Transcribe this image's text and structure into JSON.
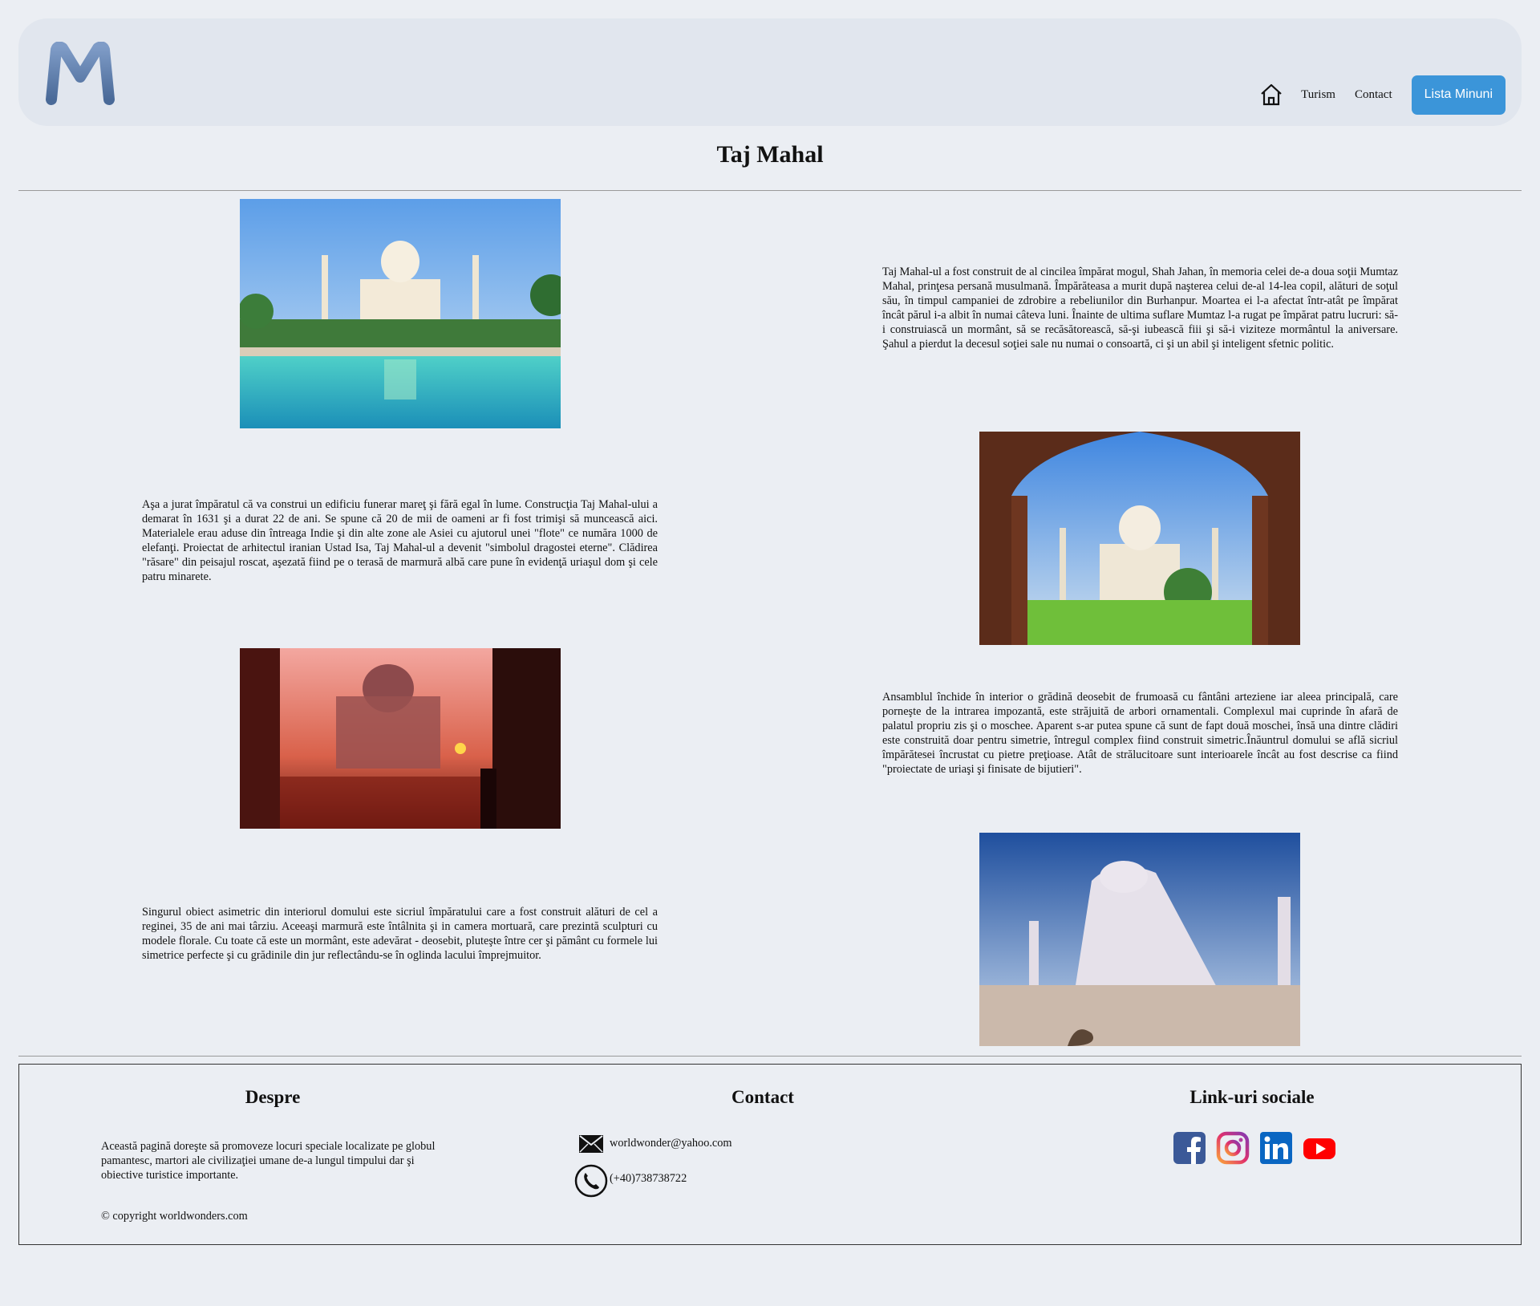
{
  "header": {
    "logo_letter": "M",
    "nav": {
      "home_icon": "home-icon",
      "turism": "Turism",
      "contact": "Contact",
      "cta": "Lista Minuni"
    },
    "colors": {
      "cta": "#3b95d9",
      "header_bg": "#e1e6ee",
      "page_bg": "#ebeef3"
    }
  },
  "main": {
    "title": "Taj Mahal",
    "paragraphs": [
      "Taj Mahal-ul a fost construit de al cincilea împărat mogul, Shah Jahan, în memoria celei de-a doua soţii Mumtaz Mahal, prinţesa persană musulmană. Împărăteasa a murit după naşterea celui de-al 14-lea copil, alături de soţul său, în timpul campaniei de zdrobire a rebeliunilor din Burhanpur. Moartea ei l-a afectat într-atât pe împărat încât părul i-a albit în numai câteva luni. Înainte de ultima suflare Mumtaz l-a rugat pe împărat patru lucruri: să-i construiască un mormânt, să se recăsătorească, să-şi iubească fiii şi să-i viziteze mormântul la aniversare. Şahul a pierdut la decesul soţiei sale nu numai o consoartă, ci şi un abil şi inteligent sfetnic politic.",
      "Aşa a jurat împăratul că va construi un edificiu funerar mareţ şi fără egal în lume. Construcţia Taj Mahal-ului a demarat în 1631 şi a durat 22 de ani. Se spune că 20 de mii de oameni ar fi fost trimişi să muncească aici. Materialele erau aduse din întreaga Indie şi din alte zone ale Asiei cu ajutorul unei \"flote\" ce număra 1000 de elefanţi. Proiectat de arhitectul iranian Ustad Isa, Taj Mahal-ul a devenit \"simbolul dragostei eterne\". Clădirea \"răsare\" din peisajul roscat, aşezată fiind pe o terasă de marmură albă care pune în evidenţă uriaşul dom şi cele patru minarete.",
      "Ansamblul închide în interior o grădină deosebit de frumoasă cu fântâni arteziene iar aleea principală, care porneşte de la intrarea impozantă, este străjuită de arbori ornamentali. Complexul mai cuprinde în afară de palatul propriu zis şi o moschee. Aparent s-ar putea spune că sunt de fapt două moschei, însă una dintre clădiri este construită doar pentru simetrie, întregul complex fiind construit simetric.Înăuntrul domului se află sicriul împărătesei încrustat cu pietre preţioase. Atât de strălucitoare sunt interioarele încât au fost descrise ca fiind \"proiectate de uriaşi şi finisate de bijutieri\".",
      "Singurul obiect asimetric din interiorul domului este sicriul împăratului care a fost construit alături de cel a reginei, 35 de ani mai târziu. Aceeaşi marmură este întâlnita şi in camera mortuară, care prezintă sculpturi cu modele florale. Cu toate că este un mormânt, este adevărat - deosebit, pluteşte între cer şi pământ cu formele lui simetrice perfecte şi cu grădinile din jur reflectându-se în oglinda lacului împrejmuitor."
    ]
  },
  "footer": {
    "about": {
      "title": "Despre",
      "text": "Această pagină doreşte să promoveze locuri speciale localizate pe globul pamantesc, martori ale civilizaţiei umane de-a lungul timpului dar şi obiective turistice importante.",
      "copyright": "© copyright worldwonders.com"
    },
    "contact": {
      "title": "Contact",
      "email": "worldwonder@yahoo.com",
      "phone": "(+40)738738722",
      "email_icon": "envelope-icon",
      "phone_icon": "phone-icon"
    },
    "social": {
      "title": "Link-uri sociale",
      "icons": [
        "facebook-icon",
        "instagram-icon",
        "linkedin-icon",
        "youtube-icon"
      ]
    }
  }
}
